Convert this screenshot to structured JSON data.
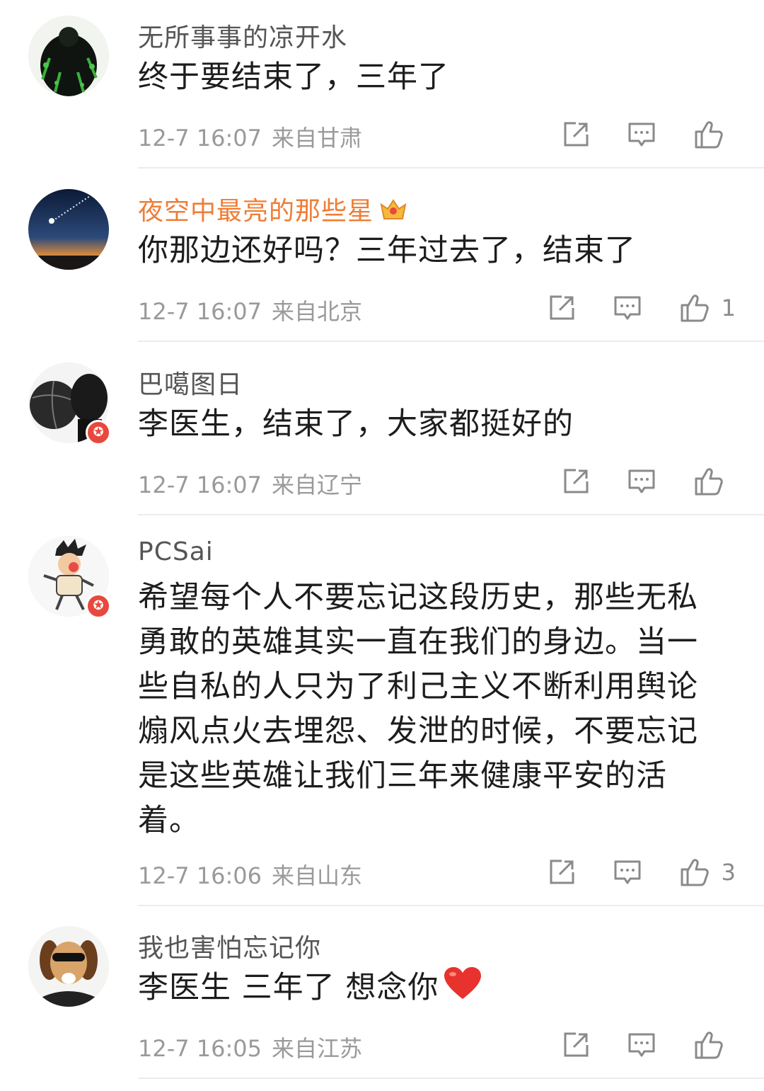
{
  "comments": [
    {
      "username": "无所事事的凉开水",
      "text": "终于要结束了，三年了",
      "time": "12-7 16:07",
      "location": "来自甘肃",
      "likes": ""
    },
    {
      "username": "夜空中最亮的那些星",
      "text": "你那边还好吗？三年过去了，结束了",
      "time": "12-7 16:07",
      "location": "来自北京",
      "likes": "1"
    },
    {
      "username": "巴噶图日",
      "text": "李医生，结束了，大家都挺好的",
      "time": "12-7 16:07",
      "location": "来自辽宁",
      "likes": ""
    },
    {
      "username": "PCSai",
      "text": "希望每个人不要忘记这段历史，那些无私勇敢的英雄其实一直在我们的身边。当一些自私的人只为了利己主义不断利用舆论煽风点火去埋怨、发泄的时候，不要忘记是这些英雄让我们三年来健康平安的活着。",
      "time": "12-7 16:06",
      "location": "来自山东",
      "likes": "3"
    },
    {
      "username": "我也害怕忘记你",
      "text": "李医生 三年了 想念你",
      "time": "12-7 16:05",
      "location": "来自江苏",
      "likes": ""
    }
  ],
  "icons": {
    "share": "share-icon",
    "reply": "comment-icon",
    "like": "thumbs-up-icon",
    "vip": "crown-icon",
    "heart": "heart-emoji-icon",
    "verified": "star-badge-icon"
  },
  "colors": {
    "vip_name": "#f07c35",
    "badge": "#e8483d",
    "heart": "#e8322e"
  }
}
